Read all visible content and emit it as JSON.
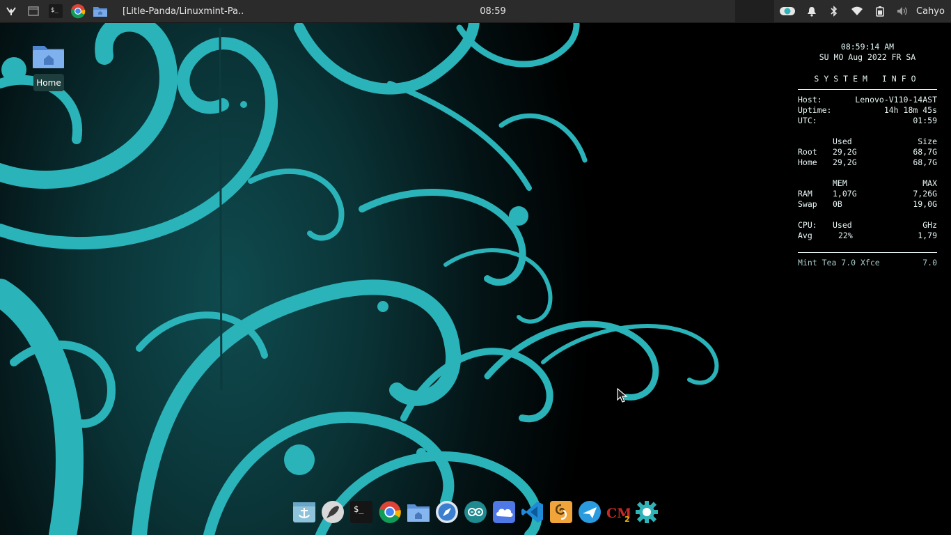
{
  "top_panel": {
    "launchers": [
      {
        "name": "whisker-menu-icon"
      },
      {
        "name": "show-desktop-icon"
      },
      {
        "name": "terminal-icon"
      },
      {
        "name": "chrome-icon"
      },
      {
        "name": "file-manager-icon"
      }
    ],
    "active_window": {
      "icon": "chrome-icon",
      "title": "[Litle-Panda/Linuxmint-Pa..."
    },
    "clock": "08:59",
    "tray": [
      "toggle-icon",
      "notification-bell-icon",
      "bluetooth-icon",
      "wifi-icon",
      "battery-icon",
      "volume-icon"
    ],
    "user": "Cahyo"
  },
  "desktop": {
    "home_icon": {
      "label": "Home"
    }
  },
  "conky": {
    "time": "08:59:14 AM",
    "calendar_line": "SU MO Aug 2022 FR SA",
    "title": "SYSTEM INFO",
    "host_label": "Host:",
    "host_value": "Lenovo-V110-14AST",
    "uptime_label": "Uptime:",
    "uptime_value": "14h 18m 45s",
    "utc_label": "UTC:",
    "utc_value": "01:59",
    "disk_header": {
      "used": "Used",
      "size": "Size"
    },
    "disks": [
      {
        "name": "Root",
        "used": "29,2G",
        "size": "68,7G"
      },
      {
        "name": "Home",
        "used": "29,2G",
        "size": "68,7G"
      }
    ],
    "mem_header": {
      "used": "MEM",
      "max": "MAX"
    },
    "mem": [
      {
        "name": "RAM",
        "used": "1,07G",
        "max": "7,26G"
      },
      {
        "name": "Swap",
        "used": "0B",
        "max": "19,0G"
      }
    ],
    "cpu_header": {
      "label": "CPU:",
      "used": "Used",
      "ghz": "GHz"
    },
    "cpu": {
      "name": "Avg",
      "used": "22%",
      "ghz": "1,79"
    },
    "footer_left": "Mint Tea 7.0 Xfce",
    "footer_right": "7.0"
  },
  "dock": {
    "items": [
      "anchor-app-icon",
      "rocket-launcher-icon",
      "terminal-icon",
      "chrome-icon",
      "file-manager-icon",
      "compass-icon",
      "arduino-icon",
      "cloud-sync-icon",
      "vscode-icon",
      "sublime-icon",
      "aurora-plane-icon",
      "cm2-icon",
      "settings-gear-icon"
    ]
  },
  "colors": {
    "accent": "#2fb3b8",
    "panel_bg": "#2b2b2b",
    "text": "#e6e6e6"
  }
}
